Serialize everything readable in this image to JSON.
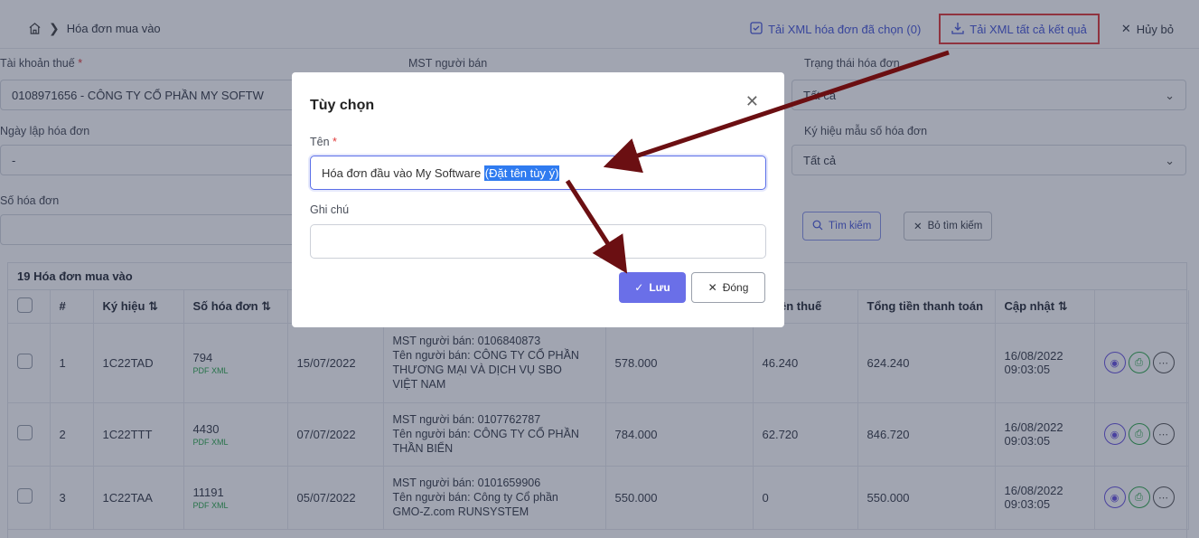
{
  "breadcrumb": {
    "current": "Hóa đơn mua vào"
  },
  "top_actions": {
    "download_selected": "Tải XML hóa đơn đã chọn (0)",
    "download_all": "Tải XML tất cả kết quả",
    "cancel": "Hủy bỏ"
  },
  "filters": {
    "tax_account_label": "Tài khoản thuế",
    "tax_account_value": "0108971656 - CÔNG TY CỔ PHẦN MY SOFTW",
    "seller_tax_label": "MST người bán",
    "status_label": "Trạng thái hóa đơn",
    "status_value": "Tất cả",
    "date_label": "Ngày lập hóa đơn",
    "date_value": "-",
    "template_label": "Ký hiệu mẫu số hóa đơn",
    "template_value": "Tất cả",
    "invoice_no_label": "Số hóa đơn",
    "search_button": "Tìm kiếm",
    "clear_button": "Bỏ tìm kiếm"
  },
  "table": {
    "title": "19 Hóa đơn mua vào",
    "headers": [
      "#",
      "Ký hiệu ⇅",
      "Số hóa đơn ⇅",
      "",
      "",
      "",
      "g tiền thuế",
      "Tổng tiền thanh toán",
      "Cập nhật ⇅"
    ],
    "rows": [
      {
        "index": "1",
        "symbol": "1C22TAD",
        "number": "794",
        "file": "PDF XML",
        "date": "15/07/2022",
        "seller": [
          "MST người bán: 0106840873",
          "Tên người bán: CÔNG TY CỔ PHẦN",
          "THƯƠNG MẠI VÀ DỊCH VỤ SBO",
          "VIỆT NAM"
        ],
        "amount": "578.000",
        "tax": "46.240",
        "total": "624.240",
        "updated": [
          "16/08/2022",
          "09:03:05"
        ]
      },
      {
        "index": "2",
        "symbol": "1C22TTT",
        "number": "4430",
        "file": "PDF XML",
        "date": "07/07/2022",
        "seller": [
          "MST người bán: 0107762787",
          "Tên người bán: CÔNG TY CỔ PHẦN",
          "THẦN BIỂN"
        ],
        "amount": "784.000",
        "tax": "62.720",
        "total": "846.720",
        "updated": [
          "16/08/2022",
          "09:03:05"
        ]
      },
      {
        "index": "3",
        "symbol": "1C22TAA",
        "number": "11191",
        "file": "PDF XML",
        "date": "05/07/2022",
        "seller": [
          "MST người bán: 0101659906",
          "Tên người bán: Công ty Cổ phần",
          "GMO-Z.com RUNSYSTEM"
        ],
        "amount": "550.000",
        "tax": "0",
        "total": "550.000",
        "updated": [
          "16/08/2022",
          "09:03:05"
        ]
      }
    ]
  },
  "modal": {
    "title": "Tùy chọn",
    "name_label": "Tên",
    "name_value_plain": "Hóa đơn đầu vào My Software ",
    "name_value_selected": "(Đặt tên tùy ý)",
    "note_label": "Ghi chú",
    "note_value": "",
    "save_button": "Lưu",
    "close_button": "Đóng"
  },
  "colors": {
    "accent": "#4a5ad9",
    "required": "#e03a3a",
    "highlight_border": "#e23b3b",
    "arrow": "#6b0f12",
    "selection": "#2f7bf0"
  }
}
